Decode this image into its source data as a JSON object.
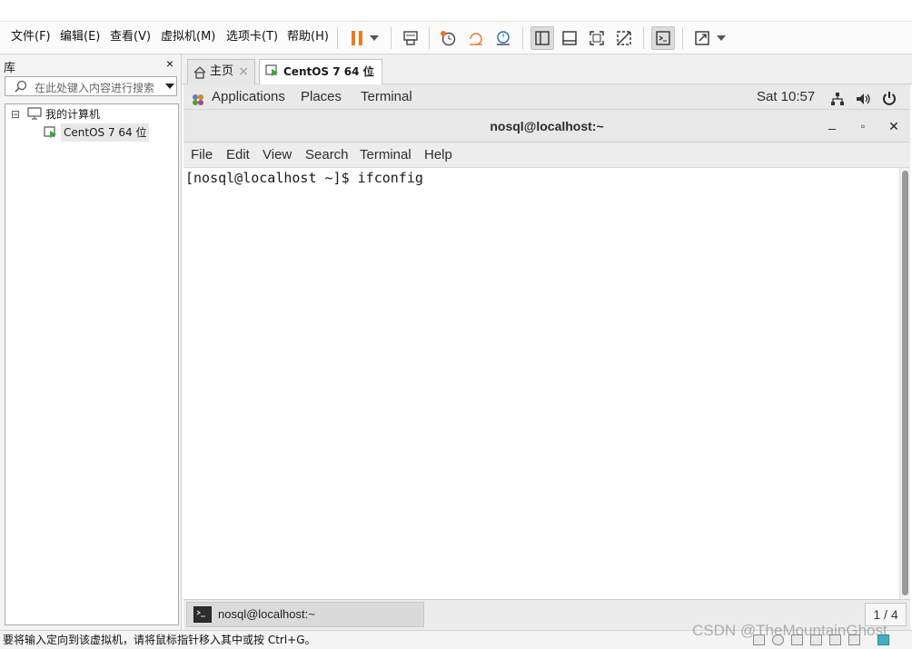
{
  "vm": {
    "menu": [
      "文件(F)",
      "编辑(E)",
      "查看(V)",
      "虚拟机(M)",
      "选项卡(T)",
      "帮助(H)"
    ],
    "toolbar_icons": [
      "pause-icon",
      "dropdown-arrow-icon",
      "send-ctrl-alt-del-icon",
      "snapshot-take-icon",
      "snapshot-revert-icon",
      "snapshot-manager-icon",
      "show-library-icon",
      "show-thumbnail-icon",
      "full-screen-icon",
      "unity-icon",
      "console-view-icon",
      "stretch-view-icon",
      "view-dropdown-icon"
    ]
  },
  "library": {
    "title": "库",
    "close": "×",
    "search_placeholder": "在此处键入内容进行搜索",
    "tree": {
      "root": "我的计算机",
      "toggle": "⊟",
      "child": "CentOS 7 64 位"
    }
  },
  "tabs": [
    {
      "label": "主页",
      "close": "×",
      "icon": "home-icon",
      "active": false
    },
    {
      "label": "CentOS 7 64 位",
      "close": "×",
      "icon": "vm-running-icon",
      "active": true
    }
  ],
  "guest": {
    "top_bar": {
      "applications": "Applications",
      "places": "Places",
      "terminal": "Terminal",
      "clock": "Sat 10:57"
    },
    "terminal_window": {
      "title": "nosql@localhost:~",
      "minimize": "_",
      "maximize": "▫",
      "close": "✕",
      "menu": [
        "File",
        "Edit",
        "View",
        "Search",
        "Terminal",
        "Help"
      ],
      "prompt_line": "[nosql@localhost ~]$ ifconfig"
    },
    "taskbar": {
      "item": "nosql@localhost:~",
      "pager": "1 / 4"
    }
  },
  "status_bar": {
    "message": "要将输入定向到该虚拟机，请将鼠标指针移入其中或按 Ctrl+G。",
    "watermark": "CSDN @TheMountainGhost"
  },
  "colors": {
    "pause_orange": "#f07a1a",
    "vm_green": "#3aa83a",
    "terminal_bg": "#ffffff"
  }
}
